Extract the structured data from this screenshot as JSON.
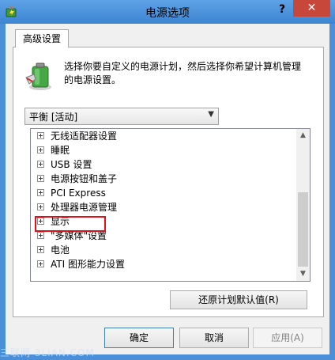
{
  "window": {
    "title": "电源选项",
    "help_label": "?",
    "close_label": "✕"
  },
  "tab": {
    "label": "高级设置"
  },
  "description": "选择你要自定义的电源计划，然后选择你希望计算机管理的电源设置。",
  "plan_select": {
    "value": "平衡 [活动]"
  },
  "tree_items": [
    "无线适配器设置",
    "睡眠",
    "USB 设置",
    "电源按钮和盖子",
    "PCI Express",
    "处理器电源管理",
    "显示",
    "\"多媒体\"设置",
    "电池",
    "ATI 图形能力设置"
  ],
  "highlighted_item": "显示",
  "buttons": {
    "restore": "还原计划默认值(R)",
    "ok": "确定",
    "cancel": "取消",
    "apply": "应用(A)"
  },
  "watermark": "三联网 3LIAN.COM",
  "colors": {
    "title_bar": "#4a8fd8",
    "close_button": "#c7473a",
    "highlight": "#e0101a"
  },
  "icons": [
    "power-options-icon",
    "battery-plan-icon",
    "plus-expander-icon",
    "scroll-up-arrow-icon",
    "scroll-down-arrow-icon",
    "dropdown-arrow-icon"
  ]
}
